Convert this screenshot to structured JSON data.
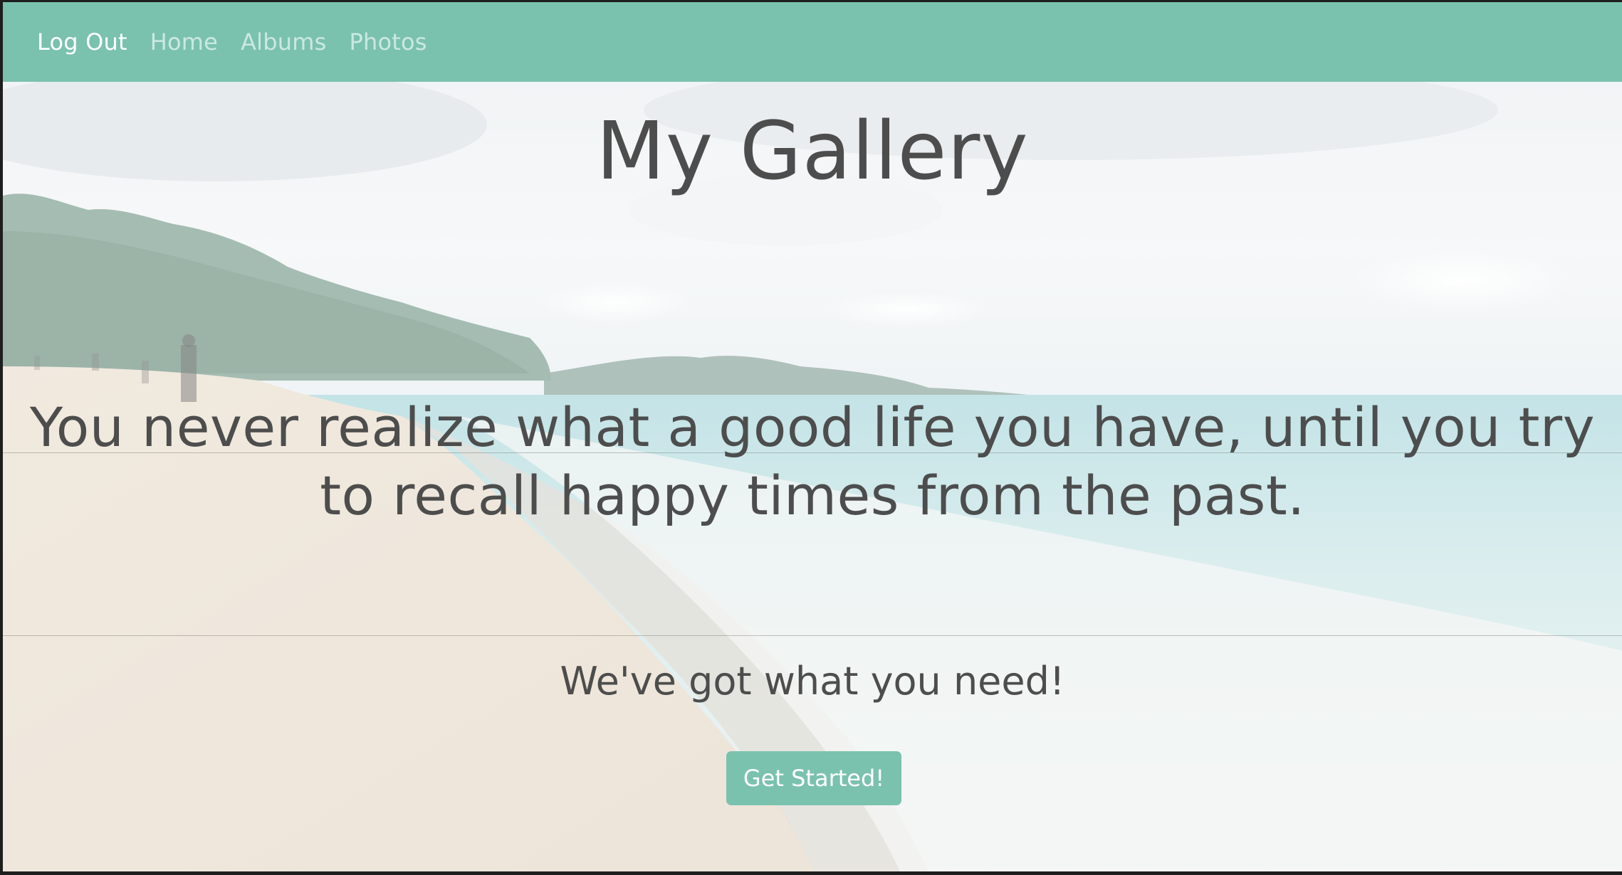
{
  "navbar": {
    "links": [
      {
        "label": "Log Out",
        "active": true
      },
      {
        "label": "Home",
        "active": false
      },
      {
        "label": "Albums",
        "active": false
      },
      {
        "label": "Photos",
        "active": false
      }
    ]
  },
  "hero": {
    "title": "My Gallery",
    "quote": "You never realize what a good life you have, until you try to recall happy times from the past.",
    "subtitle": "We've got what you need!",
    "cta_label": "Get Started!"
  },
  "colors": {
    "accent": "#7ac2ae",
    "text": "#4d4d4d"
  }
}
